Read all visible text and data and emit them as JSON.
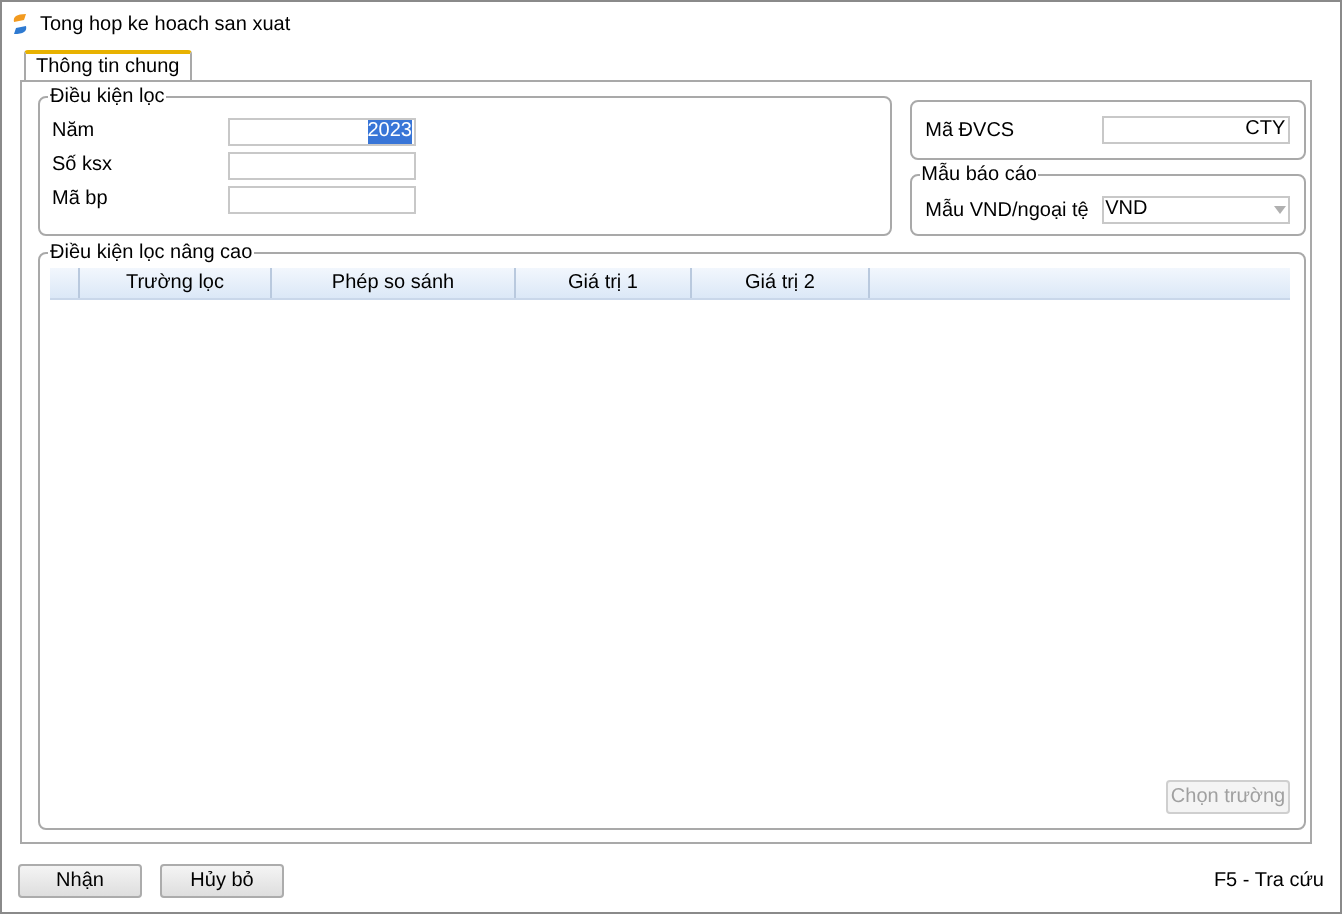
{
  "window": {
    "title": "Tong hop ke hoach san xuat"
  },
  "tabs": [
    {
      "label": "Thông tin chung",
      "selected": true
    }
  ],
  "filter_group": {
    "title": "Điều kiện lọc",
    "fields": [
      {
        "label": "Năm",
        "value": "2023",
        "selected": true
      },
      {
        "label": "Số ksx"
      },
      {
        "label": "Mã bp"
      }
    ]
  },
  "unit_field": {
    "label": "Mã ĐVCS",
    "value": "CTY"
  },
  "report_group": {
    "title": "Mẫu báo cáo",
    "fields": [
      {
        "label": "Mẫu VND/ngoại tệ",
        "value": "VND",
        "kind": "dropdown"
      }
    ]
  },
  "advanced_group": {
    "title": "Điều kiện lọc nâng cao",
    "table": {
      "columns": [
        "Trường lọc",
        "Phép so sánh",
        "Giá trị 1",
        "Giá trị 2"
      ]
    },
    "choose_button": {
      "label": "Chọn trường",
      "disabled": true
    }
  },
  "buttons": [
    "Nhận",
    "Hủy bỏ"
  ],
  "shortcut_hint": "F5 - Tra cứu"
}
